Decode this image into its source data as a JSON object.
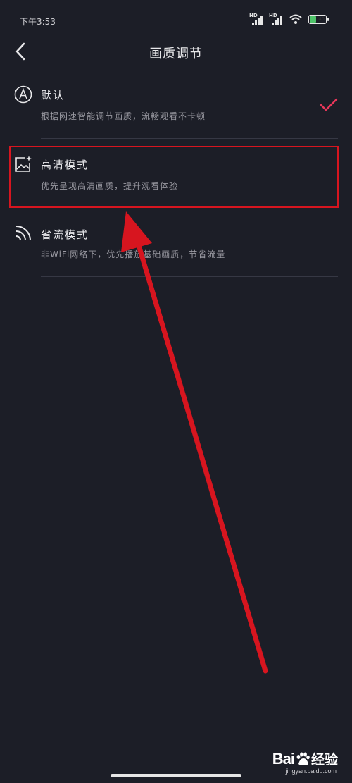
{
  "status_bar": {
    "time": "下午3:53",
    "signal_1_label": "HD",
    "signal_2_label": "HD",
    "battery_level": "40"
  },
  "header": {
    "title": "画质调节",
    "back_icon": "chevron-left-icon"
  },
  "options": [
    {
      "icon": "letter-a-circle-icon",
      "title": "默认",
      "description": "根据网速智能调节画质，流畅观看不卡顿",
      "selected": true
    },
    {
      "icon": "image-sparkle-icon",
      "title": "高清模式",
      "description": "优先呈现高清画质，提升观看体验",
      "selected": false
    },
    {
      "icon": "signal-waves-icon",
      "title": "省流模式",
      "description": "非WiFi网络下，优先播放基础画质，节省流量",
      "selected": false
    }
  ],
  "selected_mark_icon": "checkmark-icon",
  "annotation": {
    "color": "#d7151f"
  },
  "watermark": {
    "logo": "Bai",
    "logo_suffix": "经验",
    "url": "jingyan.baidu.com"
  }
}
